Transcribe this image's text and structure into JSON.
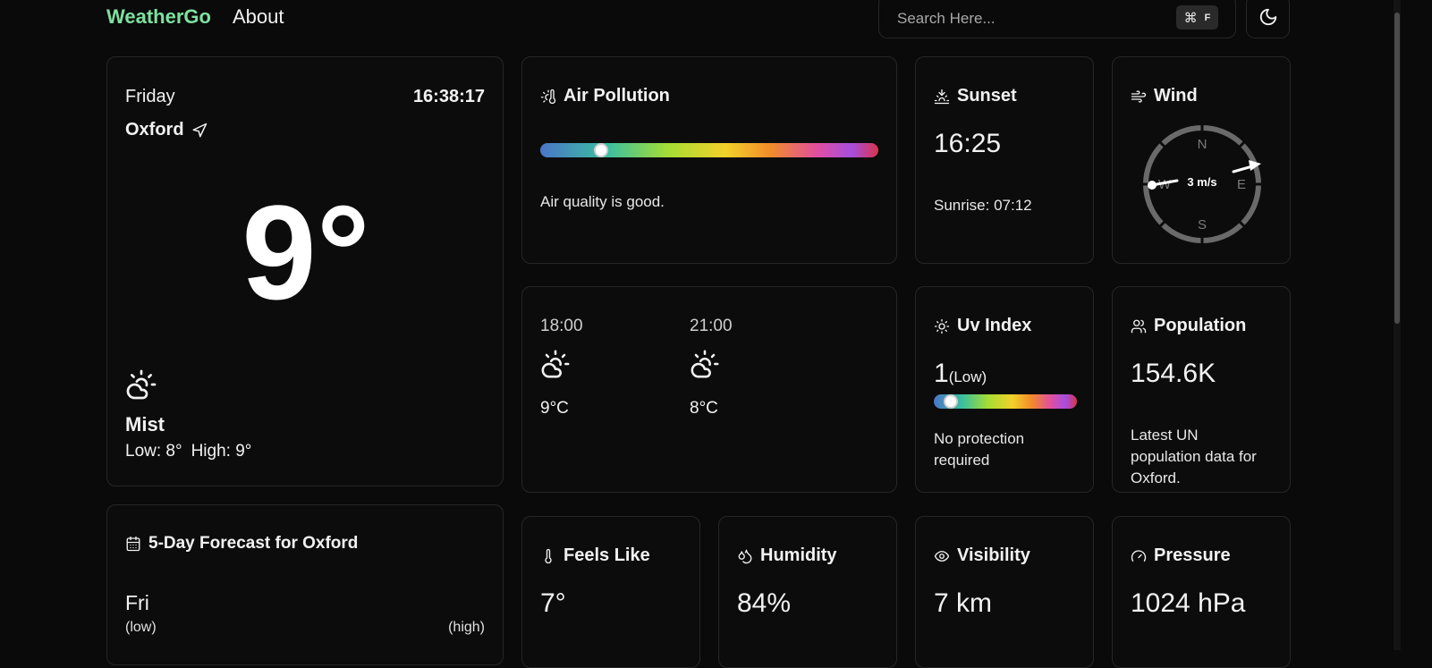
{
  "nav": {
    "brand": "WeatherGo",
    "about": "About",
    "search_placeholder": "Search Here...",
    "shortcut_symbol": "⌘",
    "shortcut_key": "F"
  },
  "current": {
    "day": "Friday",
    "time": "16:38:17",
    "city": "Oxford",
    "temp": "9°",
    "condition": "Mist",
    "low": "Low: 8°",
    "high": "High: 9°"
  },
  "air_pollution": {
    "title": "Air Pollution",
    "message": "Air quality is good.",
    "level_fraction": 0.18
  },
  "sunset": {
    "title": "Sunset",
    "time": "16:25",
    "sunrise": "Sunrise: 07:12"
  },
  "wind": {
    "title": "Wind",
    "speed": "3 m/s",
    "directions": {
      "n": "N",
      "e": "E",
      "s": "S",
      "w": "W"
    }
  },
  "hourly": [
    {
      "time": "18:00",
      "temp": "9°C",
      "icon": "cloud-sun-icon"
    },
    {
      "time": "21:00",
      "temp": "8°C",
      "icon": "cloud-sun-icon"
    }
  ],
  "uv": {
    "title": "Uv Index",
    "value": "1",
    "label": "(Low)",
    "message_line1": "No protection",
    "message_line2": "required",
    "level_fraction": 0.12
  },
  "population": {
    "title": "Population",
    "value": "154.6K",
    "line1": "Latest UN",
    "line2": "population data for",
    "line3": "Oxford."
  },
  "forecast": {
    "title": "5-Day Forecast for Oxford",
    "day": "Fri",
    "low_label": "(low)",
    "high_label": "(high)"
  },
  "feels_like": {
    "title": "Feels Like",
    "value": "7°"
  },
  "humidity": {
    "title": "Humidity",
    "value": "84%"
  },
  "visibility": {
    "title": "Visibility",
    "value": "7 km"
  },
  "pressure": {
    "title": "Pressure",
    "value": "1024 hPa"
  },
  "colors": {
    "brand": "#7ee0a0",
    "background": "#0a0a0a",
    "card_border": "#262626"
  }
}
